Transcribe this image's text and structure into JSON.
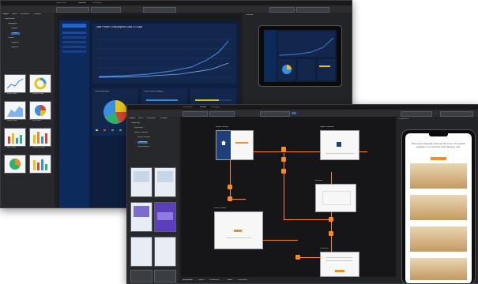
{
  "back_window": {
    "tabs": [
      "Dashboard",
      "Ultimate",
      "Prototypes"
    ],
    "sidebar_tabs": [
      "Project",
      "Menu",
      "Templates",
      "Widgets"
    ],
    "tree_items": [
      "Dashboard",
      "Navigation",
      "Header",
      "Users",
      "Charts",
      "Analytics",
      "Reports"
    ],
    "canvas_title": "Total Power Consumption Last 10 Days",
    "pie_title": "Utility Expenses",
    "bars_title": "Hours Used Category",
    "gallery_labels": [
      "Line Chart",
      "Donut Chart",
      "Area Chart",
      "Pie Chart",
      "Bar Chart",
      "Column Chart"
    ],
    "preview_label": "Preview"
  },
  "front_window": {
    "tabs": [
      "Storyboard",
      "Mobile",
      "Prototype"
    ],
    "sidebar_tabs": [
      "Project",
      "Menu",
      "Templates",
      "Widgets"
    ],
    "tree_items": [
      "Hotel App",
      "Welcome",
      "Search Results",
      "Room Details",
      "Booking",
      "Confirmation"
    ],
    "screen_labels": [
      "Home Screen",
      "Search Results",
      "Room Details",
      "Booking",
      "Checkout"
    ],
    "bottom_tabs": [
      "Storyboard",
      "Layers",
      "Interactions",
      "States",
      "Properties"
    ],
    "phone_text": "Rooms are designed to feel just like home. The perfect getaway in our luxurious hotel. Reserve now.",
    "phone_btn": "Book Now",
    "device_label": "iPhone 13"
  },
  "colors": {
    "accent": "#ff8a1f",
    "chart_blue": "#3b7ddd",
    "pie": [
      "#e8c21a",
      "#d9452b",
      "#3b8de0",
      "#2fb36b",
      "#8c56c9"
    ]
  }
}
